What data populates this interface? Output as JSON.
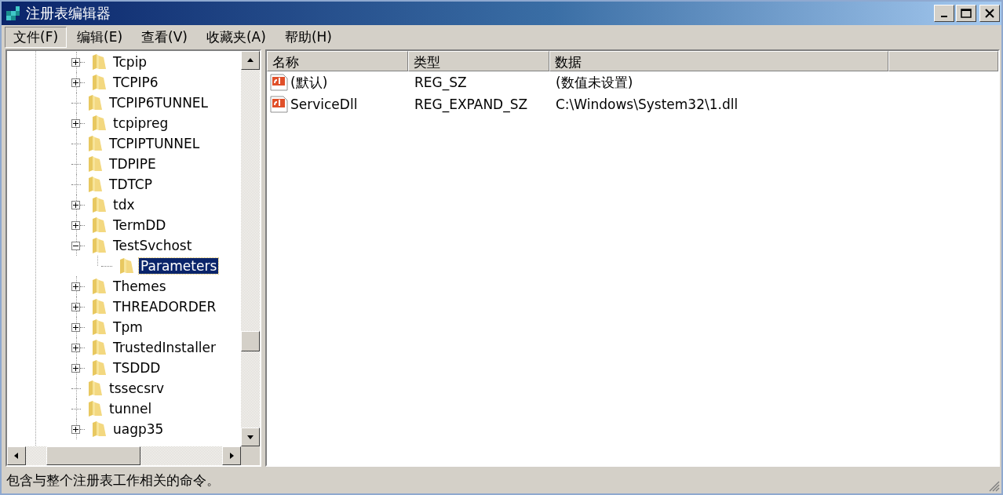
{
  "window": {
    "title": "注册表编辑器"
  },
  "menu": [
    {
      "label": "文件(F)",
      "selected": true
    },
    {
      "label": "编辑(E)",
      "selected": false
    },
    {
      "label": "查看(V)",
      "selected": false
    },
    {
      "label": "收藏夹(A)",
      "selected": false
    },
    {
      "label": "帮助(H)",
      "selected": false
    }
  ],
  "tree": [
    {
      "label": "Tcpip",
      "kind": "collapsed",
      "selected": false
    },
    {
      "label": "TCPIP6",
      "kind": "collapsed",
      "selected": false
    },
    {
      "label": "TCPIP6TUNNEL",
      "kind": "leaf",
      "selected": false
    },
    {
      "label": "tcpipreg",
      "kind": "collapsed",
      "selected": false
    },
    {
      "label": "TCPIPTUNNEL",
      "kind": "leaf",
      "selected": false
    },
    {
      "label": "TDPIPE",
      "kind": "leaf",
      "selected": false
    },
    {
      "label": "TDTCP",
      "kind": "leaf",
      "selected": false
    },
    {
      "label": "tdx",
      "kind": "collapsed",
      "selected": false
    },
    {
      "label": "TermDD",
      "kind": "collapsed",
      "selected": false
    },
    {
      "label": "TestSvchost",
      "kind": "expanded",
      "selected": false,
      "children": [
        {
          "label": "Parameters",
          "kind": "leaf",
          "selected": true
        }
      ]
    },
    {
      "label": "Themes",
      "kind": "collapsed",
      "selected": false
    },
    {
      "label": "THREADORDER",
      "kind": "collapsed",
      "selected": false
    },
    {
      "label": "Tpm",
      "kind": "collapsed",
      "selected": false
    },
    {
      "label": "TrustedInstaller",
      "kind": "collapsed",
      "selected": false
    },
    {
      "label": "TSDDD",
      "kind": "collapsed",
      "selected": false
    },
    {
      "label": "tssecsrv",
      "kind": "leaf",
      "selected": false
    },
    {
      "label": "tunnel",
      "kind": "leaf",
      "selected": false
    },
    {
      "label": "uagp35",
      "kind": "collapsed",
      "selected": false
    }
  ],
  "table": {
    "columns": [
      "名称",
      "类型",
      "数据"
    ],
    "rows": [
      [
        "(默认)",
        "REG_SZ",
        "(数值未设置)"
      ],
      [
        "ServiceDll",
        "REG_EXPAND_SZ",
        "C:\\Windows\\System32\\1.dll"
      ]
    ]
  },
  "status_bar": "包含与整个注册表工作相关的命令。"
}
